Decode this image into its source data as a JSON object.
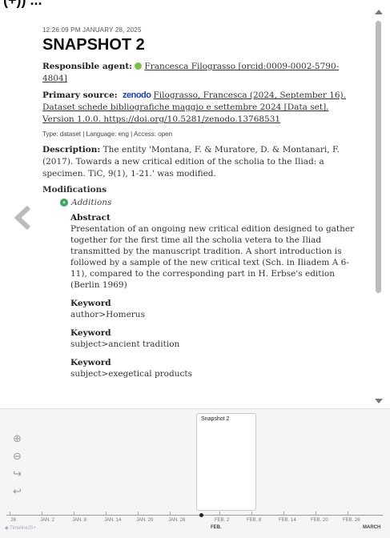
{
  "header": {
    "cut_title": "(+)) ..."
  },
  "snapshot": {
    "timestamp": "12:26:09 PM JANUARY 28, 2025",
    "title": "SNAPSHOT 2",
    "responsible_label": "Responsible agent:",
    "responsible_value_line1": "Francesca Filograsso [orcid:0009-0002-5790-",
    "responsible_value_line2": "4804]",
    "primary_label": "Primary source:",
    "primary_brand": "zenodo",
    "primary_line1": "Filograsso, Francesca (2024, September 16).",
    "primary_line2": "Dataset schede bibliografiche maggio e settembre 2024 [Data set].",
    "primary_line3": "Version 1.0.0. https://doi.org/10.5281/zenodo.13768531",
    "meta": "Type: dataset | Language: eng | Access: open",
    "description_label": "Description:",
    "description_text": "The entity 'Montana, F. & Muratore, D. & Montanari, F. (2017). Towards a new critical edition of the scholia to the Iliad: a specimen. TiC, 9(1), 1-21.' was modified.",
    "modifications_label": "Modifications",
    "additions_label": "Additions",
    "add_icon": "+",
    "fields": [
      {
        "label": "Abstract",
        "value": "Presentation of an ongoing new critical edition designed to gather together for the first time all the scholia vetera to the Iliad transmitted by the manuscript tradition. A short introduction is followed by a sample of the new critical text (Sch. in Iliadem A 6-11), compared to the corresponding part in H. Erbse's edition (Berlin 1969)"
      },
      {
        "label": "Keyword",
        "value": "author>Homerus"
      },
      {
        "label": "Keyword",
        "value": "subject>ancient tradition"
      },
      {
        "label": "Keyword",
        "value": "subject>exegetical products"
      }
    ]
  },
  "navigation": {
    "prev_icon": "chevron-left-icon"
  },
  "timeline": {
    "card_label": "Snapshot 2",
    "tools": [
      "⊕",
      "⊖",
      "↪",
      "↩"
    ],
    "axis_labels": [
      ". 26",
      "JAN. 2",
      "JAN. 8",
      "JAN. 14",
      "JAN. 20",
      "JAN. 26",
      "FEB. 2",
      "FEB. 8",
      "FEB. 14",
      "FEB. 20",
      "FEB. 26"
    ],
    "major_labels": [
      "FEB.",
      "MARCH"
    ],
    "footer": "◆ TimelineJS+"
  },
  "colors": {
    "agent_dot": "#7bc043",
    "additions": "#3aa35a",
    "zenodo": "#1a3fbd"
  }
}
